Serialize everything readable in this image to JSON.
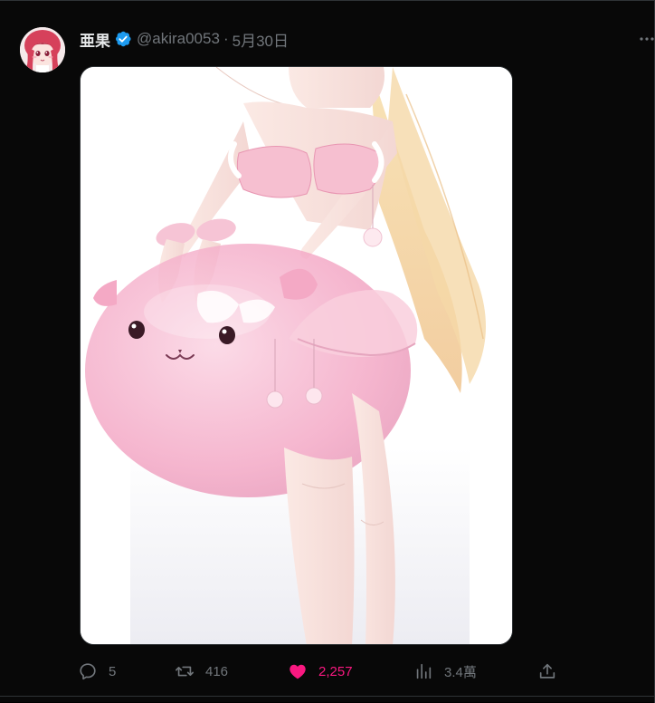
{
  "post": {
    "author": {
      "display_name": "亜果",
      "handle": "@akira0053",
      "verified": true
    },
    "separator": "·",
    "date": "5月30日",
    "more_icon": "more-horizontal-icon",
    "media": {
      "type": "illustration"
    },
    "actions": {
      "reply": {
        "icon": "reply-icon",
        "count": "5"
      },
      "repost": {
        "icon": "repost-icon",
        "count": "416"
      },
      "like": {
        "icon": "heart-filled-icon",
        "count": "2,257",
        "liked": true
      },
      "views": {
        "icon": "views-chart-icon",
        "count": "3.4萬"
      },
      "share": {
        "icon": "share-upload-icon"
      }
    }
  },
  "colors": {
    "background": "#080808",
    "text_primary": "#e7e9ea",
    "text_secondary": "#71767b",
    "verified_blue": "#1d9bf0",
    "like_pink": "#f91880",
    "border": "#2f3336"
  }
}
